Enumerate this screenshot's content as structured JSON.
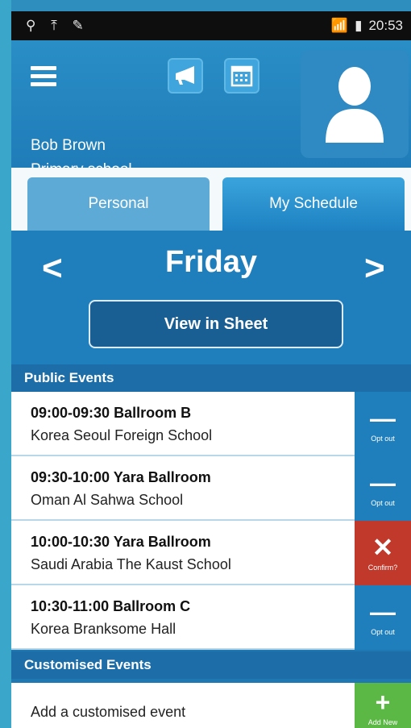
{
  "status_bar": {
    "time": "20:53"
  },
  "header": {
    "user_name": "Bob Brown",
    "user_role": "Primary school",
    "icons": [
      "menu-icon",
      "megaphone-icon",
      "calendar-icon",
      "user-avatar-icon"
    ]
  },
  "tabs": [
    {
      "label": "Personal",
      "active": false
    },
    {
      "label": "My Schedule",
      "active": true
    }
  ],
  "day_nav": {
    "prev": "<",
    "day": "Friday",
    "next": ">",
    "view_sheet_label": "View in Sheet"
  },
  "public_events": {
    "title": "Public Events",
    "items": [
      {
        "time_room": "09:00-09:30 Ballroom B",
        "school": "Korea Seoul Foreign School",
        "action_glyph": "—",
        "action_label": "Opt out",
        "action": "optout"
      },
      {
        "time_room": "09:30-10:00 Yara Ballroom",
        "school": "Oman Al Sahwa School",
        "action_glyph": "—",
        "action_label": "Opt out",
        "action": "optout"
      },
      {
        "time_room": "10:00-10:30 Yara Ballroom",
        "school": "Saudi Arabia The Kaust School",
        "action_glyph": "✕",
        "action_label": "Confirm?",
        "action": "confirm"
      },
      {
        "time_room": "10:30-11:00 Ballroom C",
        "school": "Korea Branksome Hall",
        "action_glyph": "—",
        "action_label": "Opt out",
        "action": "optout"
      }
    ]
  },
  "custom_events": {
    "title": "Customised Events",
    "add_text": "Add a customised event",
    "add_glyph": "+",
    "add_label": "Add New"
  },
  "colors": {
    "primary": "#1f7fbd",
    "confirm": "#c0392b",
    "add": "#5cb845"
  }
}
